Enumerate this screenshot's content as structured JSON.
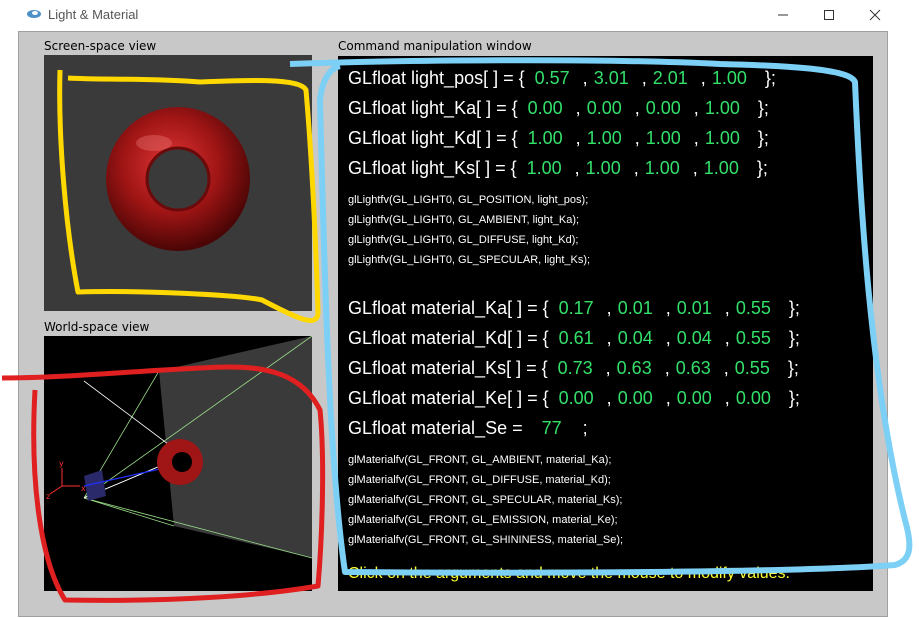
{
  "window": {
    "title": "Light & Material",
    "minimize_icon": "minimize-icon",
    "maximize_icon": "maximize-icon",
    "close_icon": "close-icon"
  },
  "panels": {
    "screen_label": "Screen-space view",
    "world_label": "World-space view",
    "command_label": "Command manipulation window"
  },
  "colors": {
    "torus": "#a01515",
    "value_green": "#33e06a",
    "note_yellow": "#ffff33",
    "annot_yellow": "#ffd800",
    "annot_red": "#e02020",
    "annot_blue": "#7ccff5"
  },
  "world_axes": {
    "y": "y",
    "x": "x",
    "z": "z"
  },
  "light_rows": [
    {
      "prefix": "GLfloat light_pos[ ] = {",
      "values": [
        "0.57",
        "3.01",
        "2.01",
        "1.00"
      ],
      "suffix": "};"
    },
    {
      "prefix": "GLfloat light_Ka[ ] = {",
      "values": [
        "0.00",
        "0.00",
        "0.00",
        "1.00"
      ],
      "suffix": "};"
    },
    {
      "prefix": "GLfloat light_Kd[ ] = {",
      "values": [
        "1.00",
        "1.00",
        "1.00",
        "1.00"
      ],
      "suffix": "};"
    },
    {
      "prefix": "GLfloat light_Ks[ ] = {",
      "values": [
        "1.00",
        "1.00",
        "1.00",
        "1.00"
      ],
      "suffix": "};"
    }
  ],
  "light_calls": [
    "glLightfv(GL_LIGHT0, GL_POSITION, light_pos);",
    "glLightfv(GL_LIGHT0, GL_AMBIENT, light_Ka);",
    "glLightfv(GL_LIGHT0, GL_DIFFUSE, light_Kd);",
    "glLightfv(GL_LIGHT0, GL_SPECULAR, light_Ks);"
  ],
  "material_rows": [
    {
      "prefix": "GLfloat material_Ka[ ] = {",
      "values": [
        "0.17",
        "0.01",
        "0.01",
        "0.55"
      ],
      "suffix": "};"
    },
    {
      "prefix": "GLfloat material_Kd[ ] = {",
      "values": [
        "0.61",
        "0.04",
        "0.04",
        "0.55"
      ],
      "suffix": "};"
    },
    {
      "prefix": "GLfloat material_Ks[ ] = {",
      "values": [
        "0.73",
        "0.63",
        "0.63",
        "0.55"
      ],
      "suffix": "};"
    },
    {
      "prefix": "GLfloat material_Ke[ ] = {",
      "values": [
        "0.00",
        "0.00",
        "0.00",
        "0.00"
      ],
      "suffix": "};"
    }
  ],
  "shininess": {
    "prefix": "GLfloat material_Se =",
    "value": "77",
    "suffix": ";"
  },
  "material_calls": [
    "glMaterialfv(GL_FRONT, GL_AMBIENT, material_Ka);",
    "glMaterialfv(GL_FRONT, GL_DIFFUSE, material_Kd);",
    "glMaterialfv(GL_FRONT, GL_SPECULAR, material_Ks);",
    "glMaterialfv(GL_FRONT, GL_EMISSION, material_Ke);",
    "glMaterialfv(GL_FRONT, GL_SHININESS, material_Se);"
  ],
  "footer_note": "Click on the arguments and move the mouse to modify values."
}
